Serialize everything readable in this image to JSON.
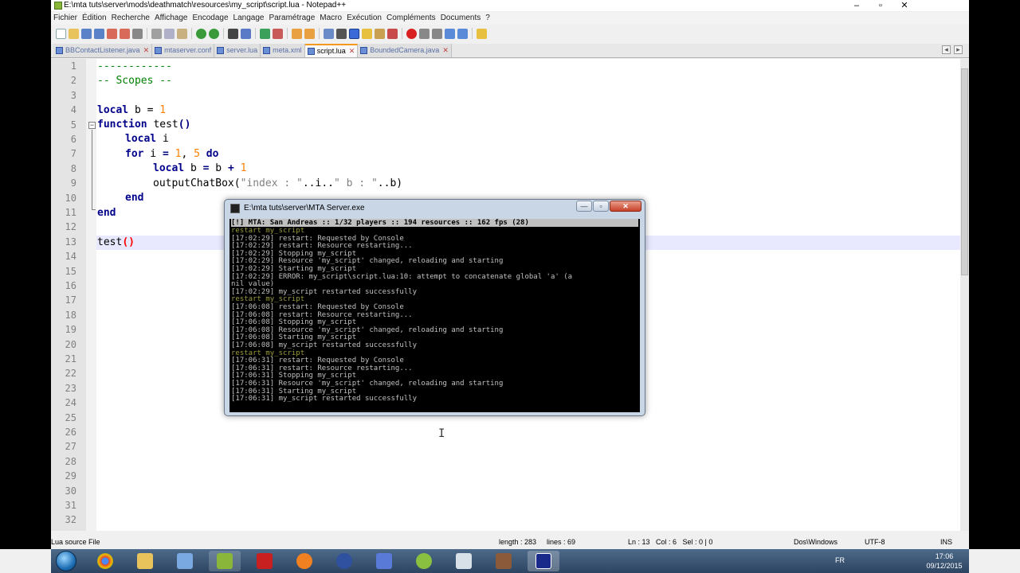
{
  "window": {
    "title": "E:\\mta tuts\\server\\mods\\deathmatch\\resources\\my_script\\script.lua - Notepad++",
    "controls": [
      "–",
      "▫",
      "✕"
    ],
    "menu_close": "X"
  },
  "menu": [
    "Fichier",
    "Édition",
    "Recherche",
    "Affichage",
    "Encodage",
    "Langage",
    "Paramétrage",
    "Macro",
    "Exécution",
    "Compléments",
    "Documents",
    "?"
  ],
  "tabs": [
    {
      "label": "BBContactListener.java",
      "active": false
    },
    {
      "label": "mtaserver.conf",
      "active": false
    },
    {
      "label": "server.lua",
      "active": false
    },
    {
      "label": "meta.xml",
      "active": false
    },
    {
      "label": "script.lua",
      "active": true
    },
    {
      "label": "BoundedCamera.java",
      "active": false
    }
  ],
  "tab_close": "✕",
  "tab_arrows": [
    "◂",
    "▸"
  ],
  "editor": {
    "line_numbers": [
      "1",
      "2",
      "3",
      "4",
      "5",
      "6",
      "7",
      "8",
      "9",
      "10",
      "11",
      "12",
      "13",
      "14",
      "15",
      "16",
      "17",
      "18",
      "19",
      "20",
      "21",
      "22",
      "23",
      "24",
      "25",
      "26",
      "27",
      "28",
      "29",
      "30",
      "31",
      "32"
    ],
    "lines": {
      "l1": "------------",
      "l2": "-- Scopes --",
      "l4_kw": "local",
      "l4_a": " b = ",
      "l4_n": "1",
      "l5_kw": "function",
      "l5_a": " test",
      "l5_p": "()",
      "l6_kw": "local",
      "l6_a": " i",
      "l7_kw": "for",
      "l7_a": " i ",
      "l7_eq": "=",
      "l7_n1": "1",
      "l7_c": ", ",
      "l7_n2": "5",
      "l7_do": "do",
      "l8_kw": "local",
      "l8_a": " b ",
      "l8_eq": "=",
      "l8_b": " b ",
      "l8_plus": "+",
      "l8_n": "1",
      "l9_a": "outputChatBox(",
      "l9_s1": "\"index : \"",
      "l9_op1": "..",
      "l9_i": "i",
      "l9_op2": "..",
      "l9_s2": "\" b : \"",
      "l9_op3": "..",
      "l9_b": "b)",
      "l10_kw": "end",
      "l11_kw": "end",
      "l13_a": "test",
      "l13_p": "()"
    },
    "fold_open": "−"
  },
  "console": {
    "title": "E:\\mta tuts\\server\\MTA Server.exe",
    "buttons": [
      "—",
      "▫",
      "✕"
    ],
    "header": "[!] MTA: San Andreas :: 1/32 players :: 194 resources :: 162 fps (28)",
    "lines": [
      {
        "t": "restart my_script",
        "y": true
      },
      {
        "t": "[17:02:29] restart: Requested by Console",
        "y": false
      },
      {
        "t": "[17:02:29] restart: Resource restarting...",
        "y": false
      },
      {
        "t": "[17:02:29] Stopping my_script",
        "y": false
      },
      {
        "t": "[17:02:29] Resource 'my_script' changed, reloading and starting",
        "y": false
      },
      {
        "t": "[17:02:29] Starting my_script",
        "y": false
      },
      {
        "t": "[17:02:29] ERROR: my_script\\script.lua:10: attempt to concatenate global 'a' (a",
        "y": false
      },
      {
        "t": "nil value)",
        "y": false
      },
      {
        "t": "[17:02:29] my_script restarted successfully",
        "y": false
      },
      {
        "t": "restart my_script",
        "y": true
      },
      {
        "t": "[17:06:08] restart: Requested by Console",
        "y": false
      },
      {
        "t": "[17:06:08] restart: Resource restarting...",
        "y": false
      },
      {
        "t": "[17:06:08] Stopping my_script",
        "y": false
      },
      {
        "t": "[17:06:08] Resource 'my_script' changed, reloading and starting",
        "y": false
      },
      {
        "t": "[17:06:08] Starting my_script",
        "y": false
      },
      {
        "t": "[17:06:08] my_script restarted successfully",
        "y": false
      },
      {
        "t": "restart my_script",
        "y": true
      },
      {
        "t": "[17:06:31] restart: Requested by Console",
        "y": false
      },
      {
        "t": "[17:06:31] restart: Resource restarting...",
        "y": false
      },
      {
        "t": "[17:06:31] Stopping my_script",
        "y": false
      },
      {
        "t": "[17:06:31] Resource 'my_script' changed, reloading and starting",
        "y": false
      },
      {
        "t": "[17:06:31] Starting my_script",
        "y": false
      },
      {
        "t": "[17:06:31] my_script restarted successfully",
        "y": false
      }
    ]
  },
  "statusbar": {
    "type": "Lua source File",
    "length": "length : 283",
    "lines": "lines : 69",
    "position": "Ln : 13   Col : 6   Sel : 0 | 0",
    "eol": "Dos\\Windows",
    "encoding": "UTF-8",
    "mode": "INS"
  },
  "taskbar": {
    "lang": "FR",
    "time": "17:06",
    "date": "09/12/2015",
    "apps": [
      "ie-icon",
      "chrome-icon",
      "explorer-icon",
      "virtualbox-icon",
      "notepadpp-icon",
      "filezilla-icon",
      "blender-icon",
      "mta-icon",
      "tetris-icon",
      "android-icon",
      "console-icon",
      "game-icon",
      "mta-server-icon"
    ]
  },
  "cursor": "I"
}
